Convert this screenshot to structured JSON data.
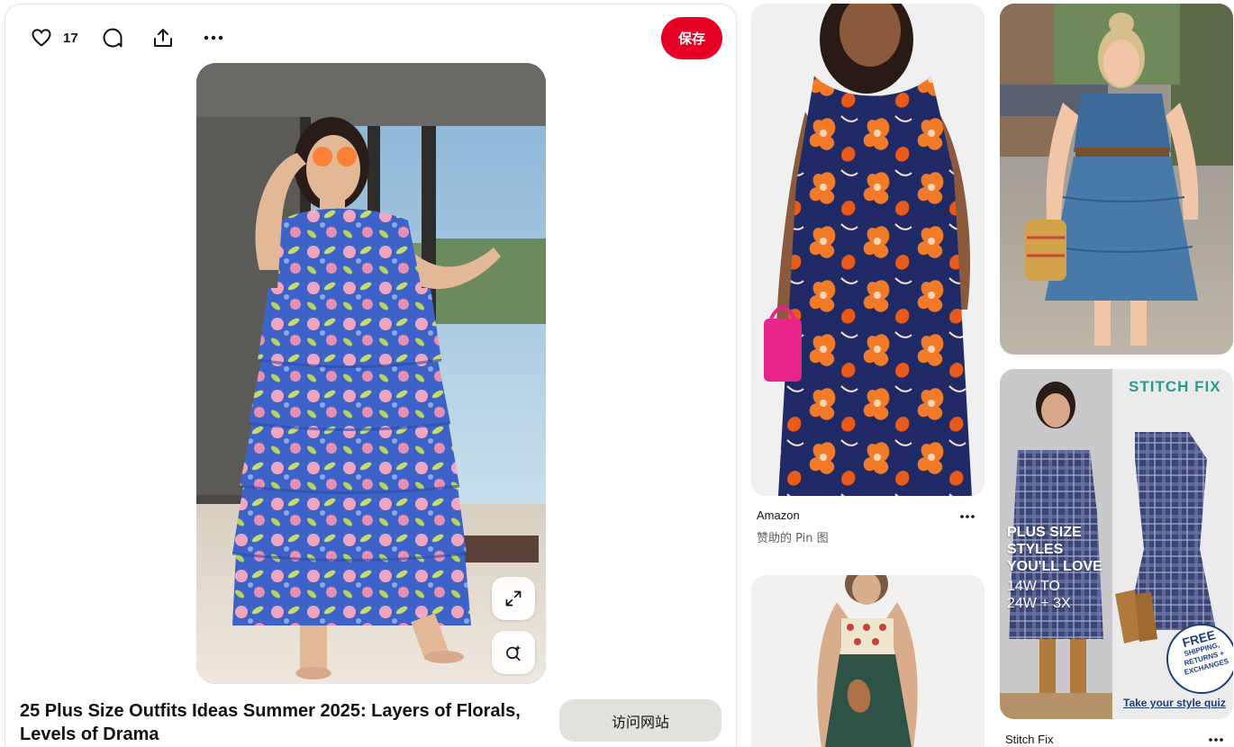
{
  "pin": {
    "like_count": "17",
    "save_label": "保存",
    "title": "25 Plus Size Outfits Ideas Summer 2025: Layers of Florals, Levels of Drama",
    "visit_label": "访问网站"
  },
  "feed": {
    "items": [
      {
        "source": "Amazon",
        "subtitle": "赞助的 Pin 图"
      },
      {
        "source": "Stitch Fix"
      }
    ],
    "ad": {
      "brand": "STITCH FIX",
      "headline_lines": [
        "PLUS SIZE",
        "STYLES",
        "YOU'LL LOVE"
      ],
      "size_lines": [
        "14W TO",
        "24W + 3X"
      ],
      "badge_lines": [
        "FREE",
        "SHIPPING,",
        "RETURNS +",
        "EXCHANGES"
      ],
      "cta": "Take your style quiz"
    }
  },
  "colors": {
    "save_red": "#e60023",
    "visit_gray": "#e2e2dd"
  },
  "icons": [
    "heart-icon",
    "comment-icon",
    "share-icon",
    "more-icon",
    "expand-icon",
    "visual-search-icon"
  ]
}
